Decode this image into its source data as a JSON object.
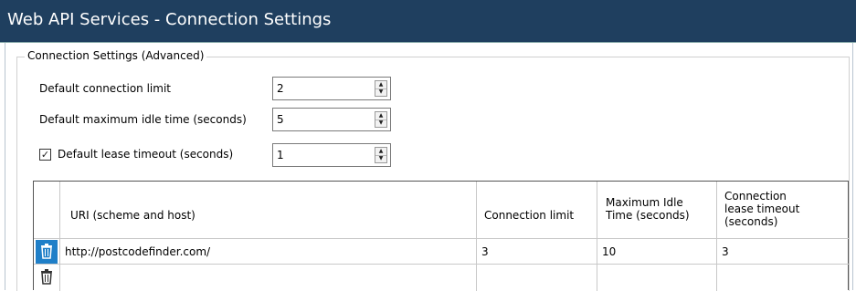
{
  "window": {
    "title": "Web API Services - Connection Settings"
  },
  "group": {
    "legend": "Connection Settings (Advanced)"
  },
  "settings": {
    "connection_limit": {
      "label": "Default connection limit",
      "value": "2"
    },
    "idle_time": {
      "label": "Default maximum idle time (seconds)",
      "value": "5"
    },
    "lease_timeout": {
      "label": "Default lease timeout (seconds)",
      "value": "1",
      "checked": true
    }
  },
  "table": {
    "headers": {
      "uri": "URI (scheme and host)",
      "connection_limit": "Connection limit",
      "idle_time_line1": "Maximum Idle",
      "idle_time_line2": "Time (seconds)",
      "lease_line1": "Connection",
      "lease_line2": "lease timeout",
      "lease_line3": "(seconds)"
    },
    "rows": [
      {
        "uri": "http://postcodefinder.com/",
        "connection_limit": "3",
        "idle_time": "10",
        "lease_timeout": "3"
      },
      {
        "uri": "",
        "connection_limit": "",
        "idle_time": "",
        "lease_timeout": ""
      }
    ]
  },
  "colors": {
    "titlebar": "#1f3f5f",
    "selected_row_icon_bg": "#1f7fc8"
  },
  "icons": {
    "delete_row": "trash-icon",
    "spin_up": "arrow-up-icon",
    "spin_down": "arrow-down-icon",
    "check": "checkmark-icon"
  }
}
